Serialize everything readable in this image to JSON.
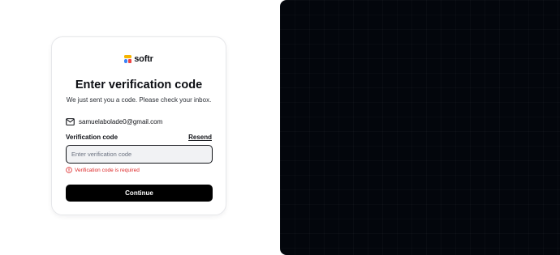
{
  "brand": {
    "name": "softr",
    "colors": {
      "yellow": "#f5b400",
      "blue": "#3b82f6",
      "red": "#ef4444"
    }
  },
  "card": {
    "title": "Enter verification code",
    "subtitle": "We just sent you a code. Please check your inbox.",
    "email": "samuelabolade0@gmail.com",
    "email_icon": "mail-icon",
    "field_label": "Verification code",
    "resend_label": "Resend",
    "input": {
      "value": "",
      "placeholder": "Enter verification code"
    },
    "error": {
      "icon": "alert-circle-icon",
      "text": "Verification code is required",
      "color": "#dc2626"
    },
    "continue_label": "Continue"
  },
  "theme": {
    "accent": "#000000",
    "panel_background": "#03060c"
  }
}
